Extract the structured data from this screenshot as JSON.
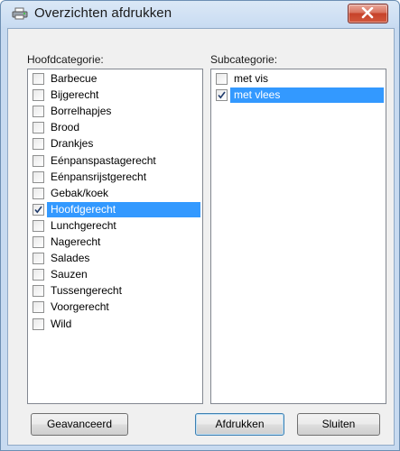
{
  "window": {
    "title": "Overzichten afdrukken",
    "app_icon": "printer-icon",
    "close_icon": "close-icon"
  },
  "main_category": {
    "label": "Hoofdcategorie:",
    "items": [
      {
        "label": "Barbecue",
        "checked": false,
        "selected": false
      },
      {
        "label": "Bijgerecht",
        "checked": false,
        "selected": false
      },
      {
        "label": "Borrelhapjes",
        "checked": false,
        "selected": false
      },
      {
        "label": "Brood",
        "checked": false,
        "selected": false
      },
      {
        "label": "Drankjes",
        "checked": false,
        "selected": false
      },
      {
        "label": "Eénpanspastagerecht",
        "checked": false,
        "selected": false
      },
      {
        "label": "Eénpansrijstgerecht",
        "checked": false,
        "selected": false
      },
      {
        "label": "Gebak/koek",
        "checked": false,
        "selected": false
      },
      {
        "label": "Hoofdgerecht",
        "checked": true,
        "selected": true
      },
      {
        "label": "Lunchgerecht",
        "checked": false,
        "selected": false
      },
      {
        "label": "Nagerecht",
        "checked": false,
        "selected": false
      },
      {
        "label": "Salades",
        "checked": false,
        "selected": false
      },
      {
        "label": "Sauzen",
        "checked": false,
        "selected": false
      },
      {
        "label": "Tussengerecht",
        "checked": false,
        "selected": false
      },
      {
        "label": "Voorgerecht",
        "checked": false,
        "selected": false
      },
      {
        "label": "Wild",
        "checked": false,
        "selected": false
      }
    ]
  },
  "sub_category": {
    "label": "Subcategorie:",
    "items": [
      {
        "label": "met vis",
        "checked": false,
        "selected": false
      },
      {
        "label": "met vlees",
        "checked": true,
        "selected": true
      }
    ]
  },
  "buttons": {
    "advanced": "Geavanceerd",
    "print": "Afdrukken",
    "close": "Sluiten"
  },
  "colors": {
    "selection": "#3399ff",
    "dialog_bg": "#f0f0f0"
  }
}
